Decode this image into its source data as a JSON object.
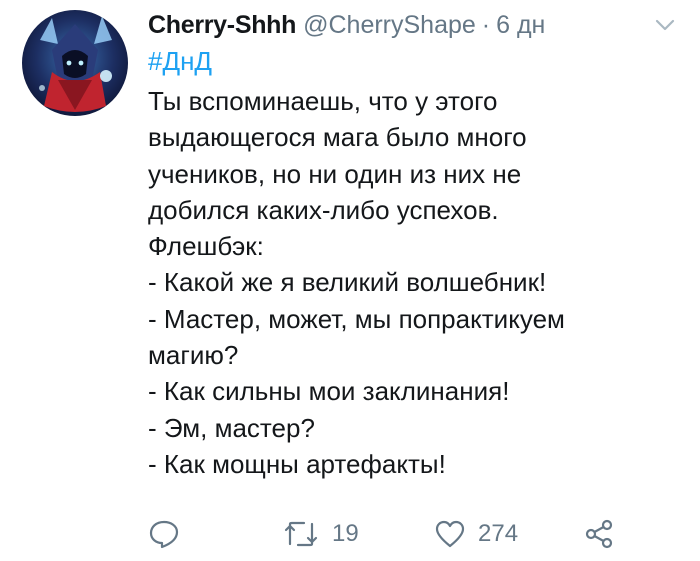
{
  "tweet": {
    "author_name": "Cherry-Shhh",
    "author_handle": "@CherryShape",
    "separator": "·",
    "time": "6 дн",
    "hashtag": "#ДнД",
    "lines": [
      "Ты вспоминаешь, что у этого",
      "выдающегося мага было много",
      "учеников, но ни один из них не",
      "добился каких-либо успехов.",
      "Флешбэк:",
      "- Какой же я великий волшебник!",
      "- Мастер, может, мы попрактикуем",
      "магию?",
      "- Как сильны мои заклинания!",
      "- Эм, мастер?",
      "- Как мощны артефакты!"
    ],
    "actions": {
      "reply_icon": "reply-icon",
      "retweet_icon": "retweet-icon",
      "retweet_count": "19",
      "like_icon": "heart-icon",
      "like_count": "274",
      "share_icon": "share-icon"
    }
  },
  "colors": {
    "text": "#14171a",
    "muted": "#657786",
    "link": "#1da1f2",
    "background": "#ffffff"
  }
}
